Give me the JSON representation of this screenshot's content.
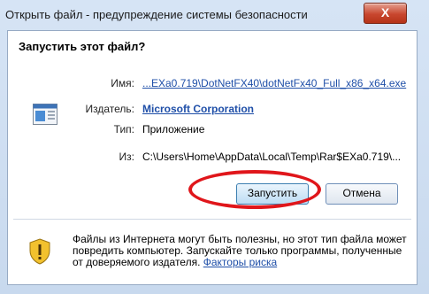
{
  "window": {
    "title": "Открыть файл - предупреждение системы безопасности",
    "close_label": "X"
  },
  "dialog": {
    "heading": "Запустить этот файл?",
    "fields": {
      "name_label": "Имя:",
      "name_value": "...EXa0.719\\DotNetFX40\\dotNetFx40_Full_x86_x64.exe",
      "publisher_label": "Издатель:",
      "publisher_value": "Microsoft Corporation",
      "type_label": "Тип:",
      "type_value": "Приложение",
      "from_label": "Из:",
      "from_value": "C:\\Users\\Home\\AppData\\Local\\Temp\\Rar$EXa0.719\\..."
    },
    "buttons": {
      "run": "Запустить",
      "cancel": "Отмена"
    },
    "warning": {
      "text": "Файлы из Интернета могут быть полезны, но этот тип файла может повредить компьютер. Запускайте только программы, полученные от доверяемого издателя. ",
      "link": "Факторы риска"
    }
  },
  "colors": {
    "highlight": "#e0161b",
    "link": "#1f4fa8"
  }
}
